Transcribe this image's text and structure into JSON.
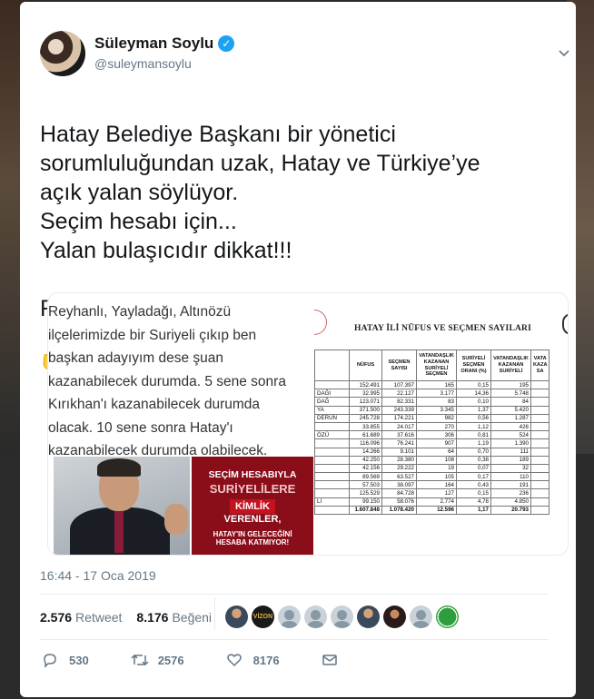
{
  "author": {
    "display_name": "Süleyman Soylu",
    "handle": "@suleymansoylu",
    "verified_glyph": "✓"
  },
  "tweet": {
    "text": "Hatay Belediye Başkanı bir yönetici\nsorumluluğundan uzak, Hatay ve Türkiye’ye\naçık yalan söylüyor.\nSeçim hesabı için...\nYalan bulaşıcıdır dikkat!!!\n\nRakamlar aşağıda",
    "emoji": "backhand-index-pointing-down"
  },
  "media": {
    "quote_text": "Reyhanlı, Yayladağı, Altınözü ilçelerimizde bir Suriyeli çıkıp ben başkan adayıyım dese şuan kazanabilecek durumda. 5 sene sonra Kırıkhan'ı kazanabilecek durumda olacak. 10 sene sonra Hatay'ı kazanabilecek durumda olabilecek.",
    "banner": {
      "line1": "SEÇİM HESABIYLA",
      "line2": "SURİYELİLERE",
      "line3": "KİMLİK",
      "line4": "VERENLER,",
      "line5": "HATAY'IN GELECEĞİNİ",
      "line6": "HESABA KATMIYOR!"
    },
    "table_title": "HATAY İLİ NÜFUS VE SEÇMEN SAYILARI",
    "table": {
      "headers": [
        "",
        "NÜFUS",
        "SEÇMEN SAYISI",
        "VATANDAŞLIK KAZANAN SURİYELİ SEÇMEN",
        "SURİYELİ SEÇMEN ORANI (%)",
        "VATANDAŞLIK KAZANAN SURİYELİ",
        "VATA KAZA SA"
      ],
      "rows": [
        [
          "",
          "152.491",
          "107.397",
          "165",
          "0,15",
          "195",
          ""
        ],
        [
          "DAĞI",
          "32.995",
          "22.127",
          "3.177",
          "14,36",
          "5.748",
          ""
        ],
        [
          "DAĞ",
          "123.071",
          "82.331",
          "83",
          "0,10",
          "84",
          ""
        ],
        [
          "YA",
          "371.500",
          "243.339",
          "3.345",
          "1,37",
          "5.420",
          ""
        ],
        [
          "DERUN",
          "245.728",
          "174.221",
          "982",
          "0,56",
          "1.287",
          ""
        ],
        [
          "",
          "33.855",
          "24.017",
          "270",
          "1,12",
          "426",
          ""
        ],
        [
          "ÖZÜ",
          "61.689",
          "37.616",
          "306",
          "0,81",
          "524",
          ""
        ],
        [
          "",
          "116.096",
          "76.241",
          "907",
          "1,19",
          "1.390",
          ""
        ],
        [
          "",
          "14.266",
          "9.101",
          "64",
          "0,70",
          "111",
          ""
        ],
        [
          "",
          "42.250",
          "28.380",
          "108",
          "0,38",
          "189",
          ""
        ],
        [
          "",
          "42.156",
          "29.222",
          "19",
          "0,07",
          "32",
          ""
        ],
        [
          "",
          "89.569",
          "63.527",
          "105",
          "0,17",
          "110",
          ""
        ],
        [
          "",
          "57.503",
          "38.097",
          "164",
          "0,43",
          "191",
          ""
        ],
        [
          "",
          "125.529",
          "84.728",
          "127",
          "0,15",
          "236",
          ""
        ],
        [
          "LI",
          "99.150",
          "58.076",
          "2.774",
          "4,78",
          "4.850",
          ""
        ]
      ],
      "total": [
        "",
        "1.607.848",
        "1.078.420",
        "12.596",
        "1,17",
        "20.793",
        ""
      ]
    }
  },
  "timestamp": "16:44 - 17 Oca 2019",
  "stats": {
    "retweet_count": "2.576",
    "retweet_label": "Retweet",
    "like_count": "8.176",
    "like_label": "Beğeni"
  },
  "likers": {
    "vizon_label": "VİZON"
  },
  "actions": {
    "reply_count": "530",
    "retweet_count": "2576",
    "like_count": "8176"
  },
  "colors": {
    "accent": "#1da1f2",
    "secondary_text": "#657786",
    "banner_red": "#8a0d1a"
  }
}
